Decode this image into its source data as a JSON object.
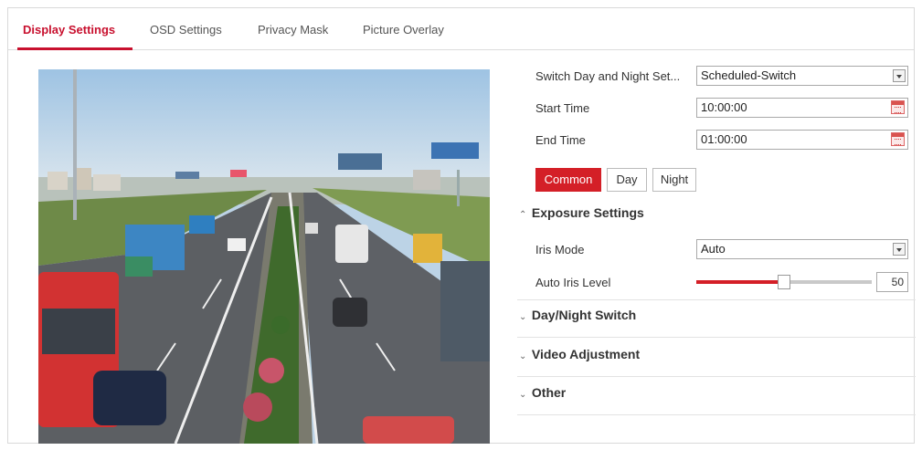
{
  "tabs": [
    {
      "label": "Display Settings",
      "active": true
    },
    {
      "label": "OSD Settings",
      "active": false
    },
    {
      "label": "Privacy Mask",
      "active": false
    },
    {
      "label": "Picture Overlay",
      "active": false
    }
  ],
  "accent_color": "#d41f27",
  "settings": {
    "switch_day_night": {
      "label": "Switch Day and Night Set...",
      "value": "Scheduled-Switch"
    },
    "start_time": {
      "label": "Start Time",
      "value": "10:00:00"
    },
    "end_time": {
      "label": "End Time",
      "value": "01:00:00"
    },
    "modes": [
      {
        "label": "Common",
        "active": true
      },
      {
        "label": "Day",
        "active": false
      },
      {
        "label": "Night",
        "active": false
      }
    ]
  },
  "sections": {
    "exposure": {
      "title": "Exposure Settings",
      "expanded": true,
      "iris_mode": {
        "label": "Iris Mode",
        "value": "Auto"
      },
      "auto_iris_level": {
        "label": "Auto Iris Level",
        "value": "50",
        "fraction": 0.5
      }
    },
    "day_night_switch": {
      "title": "Day/Night Switch",
      "expanded": false
    },
    "video_adjustment": {
      "title": "Video Adjustment",
      "expanded": false
    },
    "other": {
      "title": "Other",
      "expanded": false
    }
  },
  "icons": {
    "dropdown": "chevron-down-icon",
    "calendar": "calendar-icon",
    "collapse": "chevron-up-icon",
    "expand": "chevron-down-icon"
  }
}
